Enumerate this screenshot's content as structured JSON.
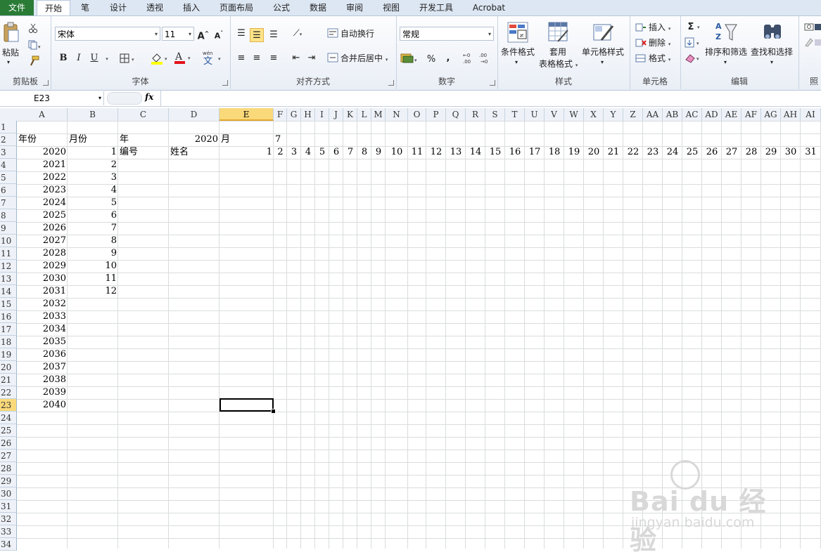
{
  "tabs": [
    {
      "label": "文件"
    },
    {
      "label": "开始"
    },
    {
      "label": "笔"
    },
    {
      "label": "设计"
    },
    {
      "label": "透视"
    },
    {
      "label": "插入"
    },
    {
      "label": "页面布局"
    },
    {
      "label": "公式"
    },
    {
      "label": "数据"
    },
    {
      "label": "审阅"
    },
    {
      "label": "视图"
    },
    {
      "label": "开发工具"
    },
    {
      "label": "Acrobat"
    }
  ],
  "ribbon": {
    "clipboard": {
      "group": "剪贴板",
      "paste": "粘贴"
    },
    "font": {
      "group": "字体",
      "name": "宋体",
      "size": "11",
      "bold": "B",
      "italic": "I",
      "underline": "U",
      "size_up": "A",
      "size_down": "A"
    },
    "align": {
      "group": "对齐方式",
      "wrap": "自动换行",
      "merge": "合并后居中"
    },
    "number": {
      "group": "数字",
      "format": "常规",
      "percent": "%",
      "comma": ","
    },
    "styles": {
      "group": "样式",
      "cond": "条件格式",
      "table1": "套用",
      "table2": "表格格式",
      "cellstyle": "单元格样式"
    },
    "cells": {
      "group": "单元格",
      "insert": "插入",
      "delete": "删除",
      "format": "格式"
    },
    "editing": {
      "group": "编辑",
      "sigma": "Σ",
      "sort": "排序和筛选",
      "find": "查找和选择"
    },
    "more": {
      "group": "照"
    }
  },
  "formula_bar": {
    "namebox": "E23",
    "fx": "fx",
    "formula": ""
  },
  "columns": [
    "A",
    "B",
    "C",
    "D",
    "E",
    "F",
    "G",
    "H",
    "I",
    "J",
    "K",
    "L",
    "M",
    "N",
    "O",
    "P",
    "Q",
    "R",
    "S",
    "T",
    "U",
    "V",
    "W",
    "X",
    "Y",
    "Z",
    "AA",
    "AB",
    "AC",
    "AD",
    "AE",
    "AF",
    "AG",
    "AH",
    "AI"
  ],
  "rows": [
    "1",
    "2",
    "3",
    "4",
    "5",
    "6",
    "7",
    "8",
    "9",
    "10",
    "11",
    "12",
    "13",
    "14",
    "15",
    "16",
    "17",
    "18",
    "19",
    "20",
    "21",
    "22",
    "23",
    "24",
    "25",
    "26",
    "27",
    "28",
    "29",
    "30",
    "31",
    "32",
    "33",
    "34"
  ],
  "selected": {
    "col": "E",
    "row": "23"
  },
  "header_row2": {
    "A": "年份",
    "B": "月份",
    "C": "年",
    "D": "2020",
    "E": "月",
    "F": "7"
  },
  "header_row3": {
    "C": "编号",
    "D": "姓名",
    "E": "1",
    "days": [
      "2",
      "3",
      "4",
      "5",
      "6",
      "7",
      "8",
      "9",
      "10",
      "11",
      "12",
      "13",
      "14",
      "15",
      "16",
      "17",
      "18",
      "19",
      "20",
      "21",
      "22",
      "23",
      "24",
      "25",
      "26",
      "27",
      "28",
      "29",
      "30",
      "31"
    ]
  },
  "years": [
    "2020",
    "2021",
    "2022",
    "2023",
    "2024",
    "2025",
    "2026",
    "2027",
    "2028",
    "2029",
    "2030",
    "2031",
    "2032",
    "2033",
    "2034",
    "2035",
    "2036",
    "2037",
    "2038",
    "2039",
    "2040"
  ],
  "months": [
    "1",
    "2",
    "3",
    "4",
    "5",
    "6",
    "7",
    "8",
    "9",
    "10",
    "11",
    "12"
  ],
  "watermark": {
    "logo": "Bai du 经验",
    "url": "jingyan.baidu.com"
  }
}
